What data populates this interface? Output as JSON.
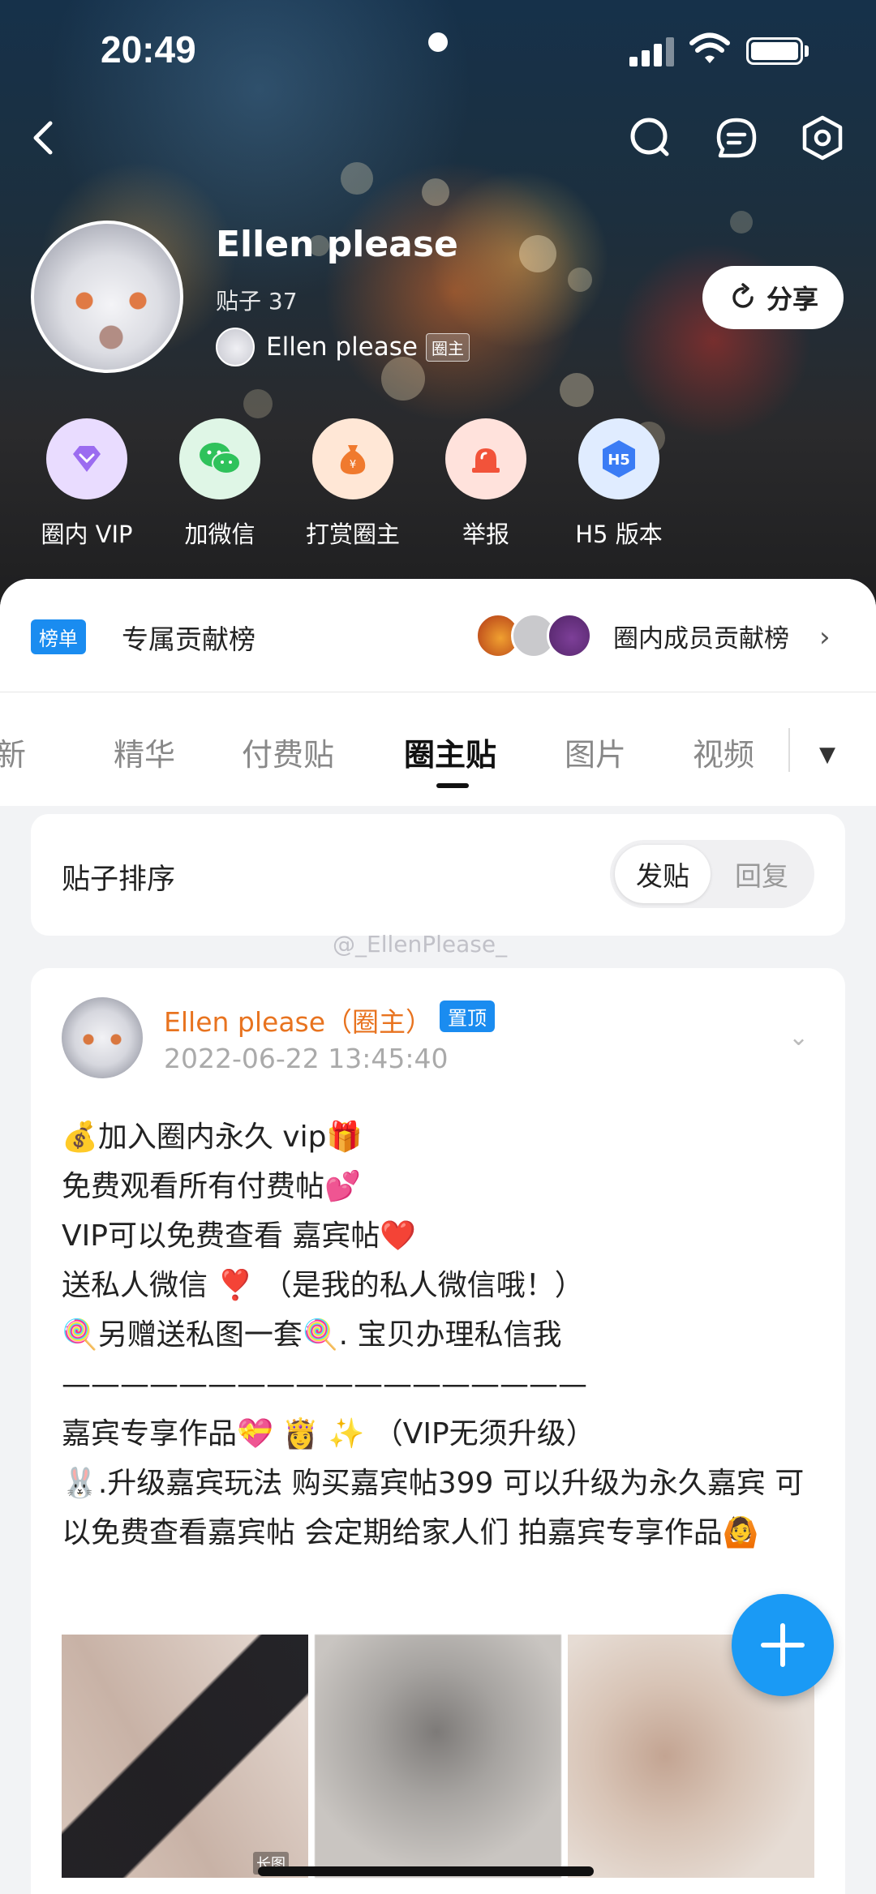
{
  "status_bar": {
    "time": "20:49"
  },
  "nav": {
    "back_icon": "back-arrow-icon",
    "search_icon": "search-icon",
    "message_icon": "message-icon",
    "settings_icon": "settings-icon"
  },
  "profile": {
    "name": "Ellen please",
    "posts": "贴子 37",
    "owner_name": "Ellen please",
    "owner_badge": "圈主",
    "share_label": "分享"
  },
  "actions": [
    {
      "label": "圈内 VIP",
      "icon": "diamond-icon",
      "color": "#e9dcff"
    },
    {
      "label": "加微信",
      "icon": "wechat-icon",
      "color": "#dff6e6"
    },
    {
      "label": "打赏圈主",
      "icon": "money-bag-icon",
      "color": "#ffe7d6"
    },
    {
      "label": "举报",
      "icon": "alarm-icon",
      "color": "#ffe2dc"
    },
    {
      "label": "H5 版本",
      "icon": "h5-icon",
      "color": "#e0ecff"
    }
  ],
  "ranking": {
    "tag": "榜单",
    "title": "专属贡献榜",
    "right_label": "圈内成员贡献榜"
  },
  "tabs": [
    {
      "label": "新",
      "active": false
    },
    {
      "label": "精华",
      "active": false
    },
    {
      "label": "付费贴",
      "active": false
    },
    {
      "label": "圈主贴",
      "active": true
    },
    {
      "label": "图片",
      "active": false
    },
    {
      "label": "视频",
      "active": false
    }
  ],
  "sort": {
    "label": "贴子排序",
    "option_active": "发贴",
    "option_inactive": "回复"
  },
  "watermark": "@_EllenPlease_",
  "post": {
    "author": "Ellen please（圈主）",
    "pin_badge": "置顶",
    "time": "2022-06-22 13:45:40",
    "lines": [
      "💰加入圈内永久 vip🎁",
      "免费观看所有付费帖💕",
      "VIP可以免费查看 嘉宾帖❤️",
      "送私人微信 ❣️ （是我的私人微信哦！）",
      "  🍭另赠送私图一套🍭. 宝贝办理私信我",
      "——————————————————",
      "        嘉宾专享作品💝 👸 ✨ （VIP无须升级）",
      "🐰.升级嘉宾玩法  购买嘉宾帖399 可以升级为永久嘉宾  可以免费查看嘉宾帖 会定期给家人们 拍嘉宾专享作品🙆"
    ],
    "image_label": "长图"
  }
}
